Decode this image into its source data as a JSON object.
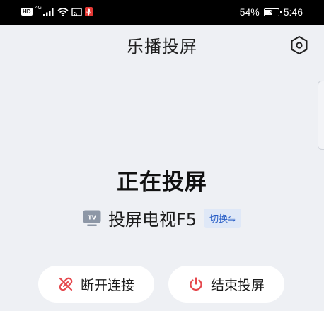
{
  "status_bar": {
    "hd": "HD",
    "network": "4G",
    "battery_percent": "54%",
    "battery_level": 0.54,
    "time": "5:46"
  },
  "header": {
    "title": "乐播投屏"
  },
  "cast": {
    "status": "正在投屏",
    "device_icon_text": "TV",
    "device_name": "投屏电视F5",
    "switch_label": "切换⇋"
  },
  "actions": {
    "disconnect_label": "断开连接",
    "stop_label": "结束投屏"
  },
  "colors": {
    "accent_red": "#e5484d",
    "switch_blue": "#2a5fc7",
    "background": "#eef0f4"
  }
}
